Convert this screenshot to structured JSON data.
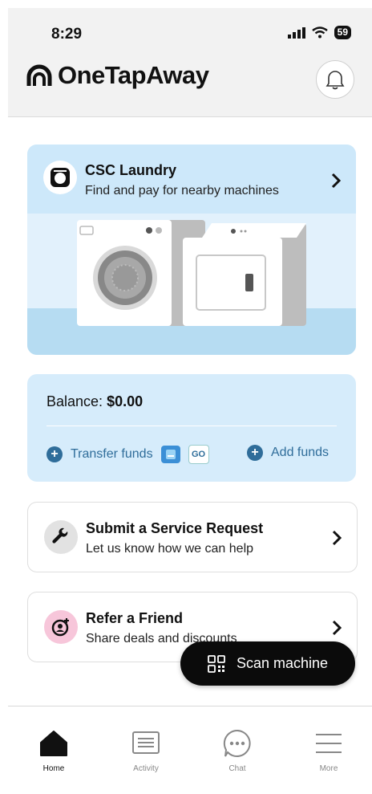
{
  "status_bar": {
    "time": "8:29",
    "battery": "59"
  },
  "header": {
    "brand": "OneTapAway"
  },
  "laundry_card": {
    "title": "CSC Laundry",
    "subtitle": "Find and pay for nearby machines"
  },
  "balance_card": {
    "label": "Balance:",
    "amount": "$0.00",
    "transfer_label": "Transfer funds",
    "go_badge": "GO",
    "add_label": "Add funds"
  },
  "service_card": {
    "title": "Submit a Service Request",
    "subtitle": "Let us know how we can help"
  },
  "refer_card": {
    "title": "Refer a Friend",
    "subtitle": "Share deals and discounts"
  },
  "scan_button": {
    "label": "Scan machine"
  },
  "tabs": [
    {
      "label": "Home",
      "icon": "home-icon"
    },
    {
      "label": "Activity",
      "icon": "activity-icon"
    },
    {
      "label": "Chat",
      "icon": "chat-icon"
    },
    {
      "label": "More",
      "icon": "menu-icon"
    }
  ],
  "colors": {
    "accent": "#2f6d9a",
    "card_blue": "#d6ecfb",
    "dark": "#0b0b0b"
  }
}
